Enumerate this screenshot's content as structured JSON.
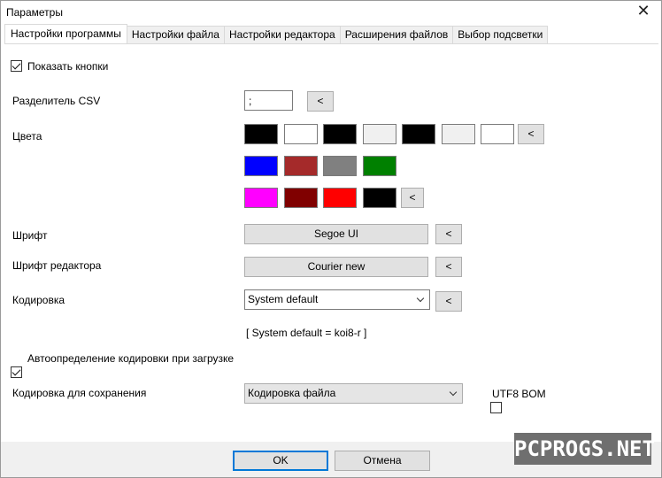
{
  "window": {
    "title": "Параметры",
    "close_glyph": "✕"
  },
  "tabs": [
    {
      "label": "Настройки программы",
      "active": true
    },
    {
      "label": "Настройки файла"
    },
    {
      "label": "Настройки редактора"
    },
    {
      "label": "Расширения файлов"
    },
    {
      "label": "Выбор подсветки"
    }
  ],
  "settings": {
    "show_buttons": {
      "label": "Показать кнопки",
      "checked": true
    },
    "csv": {
      "label": "Разделитель CSV",
      "value": ";",
      "reset_label": "<"
    },
    "colors": {
      "label": "Цвета",
      "reset_label": "<",
      "row1": [
        "#000000",
        "#ffffff",
        "#000000",
        "#f0f0f0",
        "#000000",
        "#f0f0f0",
        "#ffffff"
      ],
      "row2": [
        "#0000ff",
        "#a52a2a",
        "#808080",
        "#008000"
      ],
      "row3": [
        "#ff00ff",
        "#800000",
        "#ff0000",
        "#000000"
      ]
    },
    "font": {
      "label": "Шрифт",
      "value": "Segoe UI",
      "reset_label": "<"
    },
    "editor_font": {
      "label": "Шрифт редактора",
      "value": "Courier new",
      "reset_label": "<"
    },
    "encoding": {
      "label": "Кодировка",
      "value": "System default",
      "reset_label": "<",
      "note": "[ System default = koi8-r ]"
    },
    "auto_detect": {
      "label": "Автоопределение кодировки при загрузке",
      "checked": true
    },
    "save_encoding": {
      "label": "Кодировка для сохранения",
      "value": "Кодировка файла"
    },
    "utf8_bom": {
      "label": "UTF8 BOM",
      "checked": false
    }
  },
  "footer": {
    "ok_label": "OK",
    "cancel_label": "Отмена"
  },
  "watermark": {
    "text": "PCPROGS.NET"
  }
}
